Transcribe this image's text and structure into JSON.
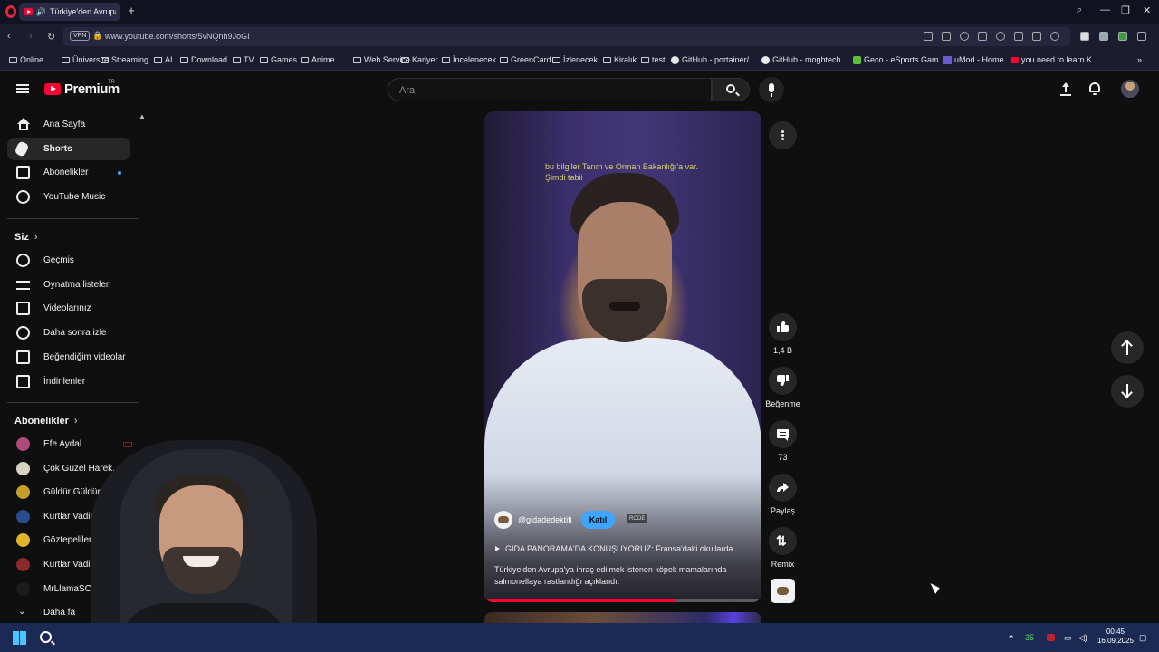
{
  "browser": {
    "tab_title": "Türkiye'den Avrupa'y",
    "new_tab_label": "+",
    "url": "www.youtube.com/shorts/5vNQhh9JoGI",
    "vpn_label": "VPN",
    "bookmarks": [
      {
        "label": "Online",
        "icon": "folder-icon"
      },
      {
        "label": "Üniversite",
        "icon": "folder-icon"
      },
      {
        "label": "Streaming",
        "icon": "folder-icon"
      },
      {
        "label": "AI",
        "icon": "folder-icon"
      },
      {
        "label": "Download",
        "icon": "folder-icon"
      },
      {
        "label": "TV",
        "icon": "folder-icon"
      },
      {
        "label": "Games",
        "icon": "folder-icon"
      },
      {
        "label": "Anime",
        "icon": "folder-icon"
      },
      {
        "label": "Web Service",
        "icon": "folder-icon"
      },
      {
        "label": "Kariyer",
        "icon": "folder-icon"
      },
      {
        "label": "İncelenecek",
        "icon": "folder-icon"
      },
      {
        "label": "GreenCard",
        "icon": "folder-icon"
      },
      {
        "label": "İzlenecek",
        "icon": "folder-icon"
      },
      {
        "label": "Kiralık",
        "icon": "folder-icon"
      },
      {
        "label": "test",
        "icon": "folder-icon"
      },
      {
        "label": "GitHub - portainer/...",
        "icon": "github-icon"
      },
      {
        "label": "GitHub - moghtech...",
        "icon": "github-icon"
      },
      {
        "label": "Geco - eSports Gam...",
        "icon": "geco-icon"
      },
      {
        "label": "uMod - Home",
        "icon": "umod-icon"
      },
      {
        "label": "you need to learn K...",
        "icon": "youtube-icon"
      }
    ],
    "more_bookmarks": "»"
  },
  "youtube": {
    "logo_text": "Premium",
    "logo_region": "TR",
    "search_placeholder": "Ara",
    "sidebar": {
      "main_items": [
        {
          "label": "Ana Sayfa",
          "icon": "home-icon",
          "active": false
        },
        {
          "label": "Shorts",
          "icon": "shorts-icon",
          "active": true
        },
        {
          "label": "Abonelikler",
          "icon": "subscriptions-icon",
          "active": false
        },
        {
          "label": "YouTube Music",
          "icon": "youtube-music-icon",
          "active": false
        }
      ],
      "you_title": "Siz",
      "you_items": [
        {
          "label": "Geçmiş",
          "icon": "history-icon"
        },
        {
          "label": "Oynatma listeleri",
          "icon": "playlists-icon"
        },
        {
          "label": "Videolarınız",
          "icon": "your-videos-icon"
        },
        {
          "label": "Daha sonra izle",
          "icon": "watch-later-icon"
        },
        {
          "label": "Beğendiğim videolar",
          "icon": "liked-videos-icon"
        },
        {
          "label": "İndirilenler",
          "icon": "downloads-icon"
        }
      ],
      "subs_title": "Abonelikler",
      "subs_items": [
        {
          "label": "Efe Aydal",
          "color": "#b04a7a"
        },
        {
          "label": "Çok Güzel Harek...",
          "color": "#d9d2c3"
        },
        {
          "label": "Güldür Güldür",
          "color": "#c4a02a"
        },
        {
          "label": "Kurtlar Vadisi Pu...",
          "color": "#2a4b8d"
        },
        {
          "label": "Göztepelilercom",
          "color": "#e0b52a"
        },
        {
          "label": "Kurtlar Vadisi",
          "color": "#8a2a2a"
        },
        {
          "label": "MrLlamaSC",
          "color": "#1b1b1b"
        },
        {
          "label": "Daha fa",
          "color": ""
        }
      ]
    },
    "short": {
      "caption": "bu bilgiler Tarım ve Orman Bakanlığı'a var. Şimdi tabii",
      "channel": "@gidadedektifi",
      "join_label": "Katıl",
      "sound_tag": "RODE",
      "playlist": "GIDA PANORAMA'DA KONUŞUYORUZ: Fransa'daki okullarda",
      "description": "Türkiye'den Avrupa'ya ihraç edilmek istenen köpek mamalarında salmonellaya rastlandığı açıklandı.",
      "progress": 0.69
    },
    "actions": {
      "likes": "1,4 B",
      "dislike_label": "Beğenme",
      "comments": "73",
      "share_label": "Paylaş",
      "remix_label": "Remix"
    }
  },
  "taskbar": {
    "tray_up": "⌃",
    "badge_green": "35",
    "time": "00:45",
    "date": "16.09.2025"
  }
}
